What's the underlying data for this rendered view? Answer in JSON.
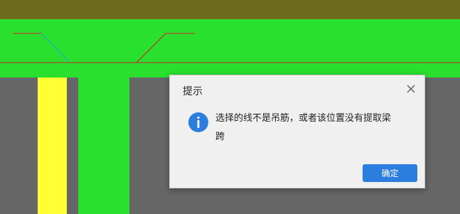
{
  "dialog": {
    "title": "提示",
    "message": "选择的线不是吊筋，或者该位置没有提取梁跨",
    "ok_label": "确定",
    "icon": "info-icon",
    "close_icon": "close-icon",
    "accent_color": "#2b7ede"
  },
  "canvas": {
    "colors": {
      "top_band": "#6e6a1e",
      "green": "#29e02e",
      "yellow": "#ffff33",
      "grey": "#666666",
      "red_line": "#cc2222",
      "blue_line": "#2a9fd6"
    }
  }
}
